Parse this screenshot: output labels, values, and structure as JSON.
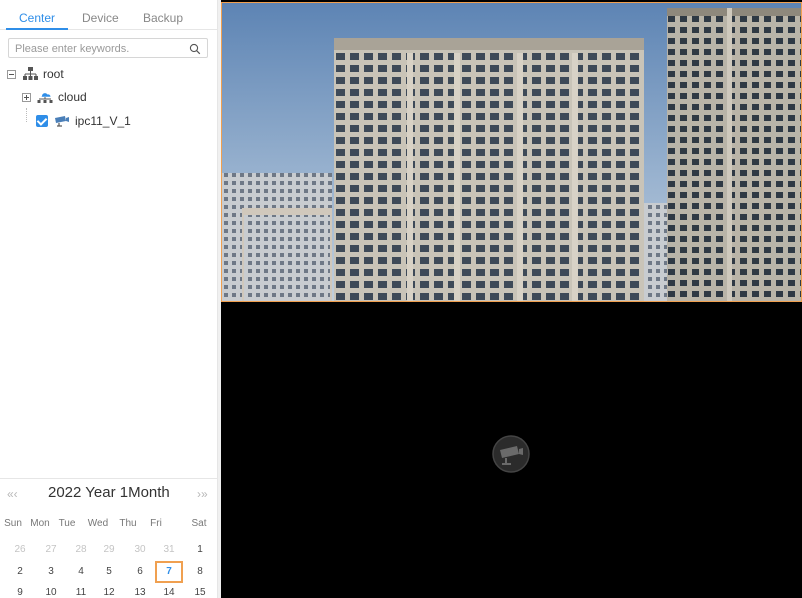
{
  "tabs": [
    "Center",
    "Device",
    "Backup"
  ],
  "search": {
    "placeholder": "Please enter keywords."
  },
  "tree": {
    "root": {
      "label": "root",
      "icon": "network-root-icon"
    },
    "cloud": {
      "label": "cloud",
      "icon": "cloud-network-icon"
    },
    "camera": {
      "label": "ipc11_V_1",
      "icon": "camera-icon",
      "checked": true
    }
  },
  "calendar": {
    "prev": "«‹",
    "next": "›»",
    "title": "2022 Year  1Month",
    "weekdays": [
      "Sun",
      "Mon",
      "Tue",
      "Wed",
      "Thu",
      "Fri",
      "Sat"
    ],
    "rows": [
      [
        "26",
        "27",
        "28",
        "29",
        "30",
        "31",
        "1"
      ],
      [
        "2",
        "3",
        "4",
        "5",
        "6",
        "7",
        "8"
      ],
      [
        "9",
        "10",
        "11",
        "12",
        "13",
        "14",
        "15"
      ]
    ],
    "selected_day": "7"
  },
  "colors": {
    "accent": "#2f8ee8",
    "selection_border": "#f0a050",
    "video_bg": "#000000"
  }
}
